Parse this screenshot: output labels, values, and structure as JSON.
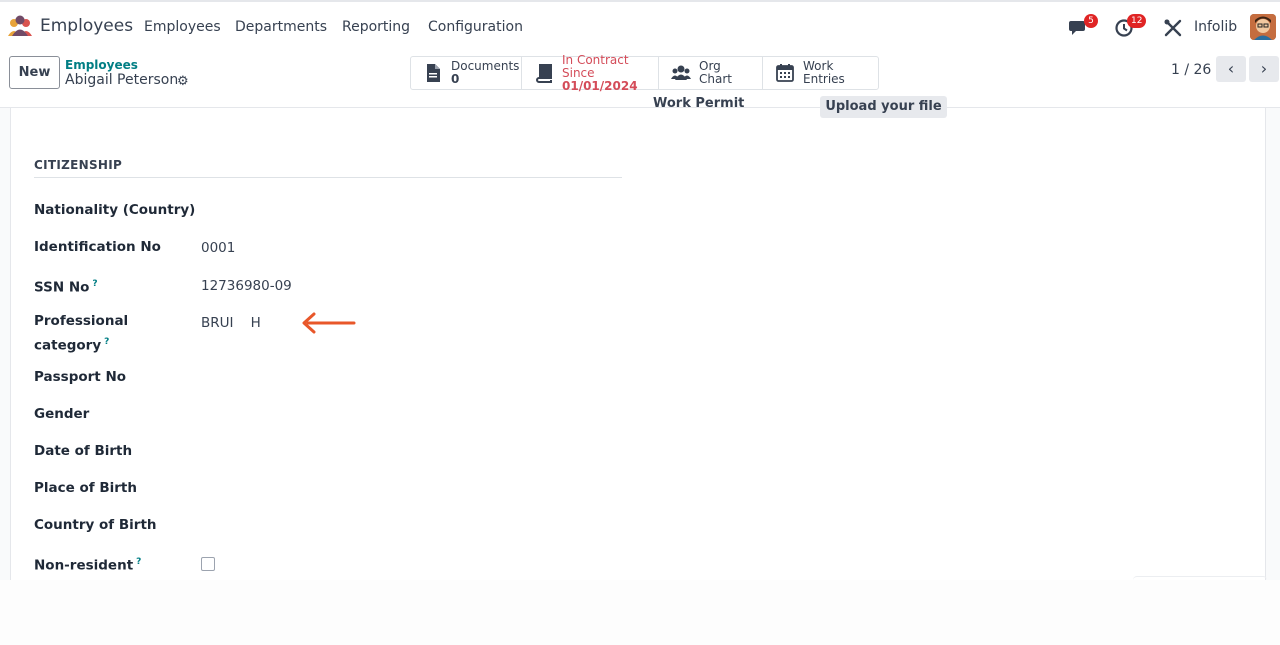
{
  "navbar": {
    "app_name": "Employees",
    "menu": [
      "Employees",
      "Departments",
      "Reporting",
      "Configuration"
    ],
    "messages_badge": "5",
    "activities_badge": "12",
    "company": "Infolib"
  },
  "control": {
    "new_label": "New",
    "breadcrumb": "Employees",
    "record_name": "Abigail Peterson",
    "smart_buttons": {
      "documents_label": "Documents",
      "documents_value": "0",
      "contract_label": "In Contract Since",
      "contract_value": "01/01/2024",
      "org_chart_label": "Org Chart",
      "work_entries_label": "Work Entries"
    },
    "pager": "1 / 26"
  },
  "form": {
    "work_permit_label": "Work Permit",
    "upload_label": "Upload your file",
    "citizenship": {
      "title": "CITIZENSHIP",
      "nationality_label": "Nationality (Country)",
      "identification_label": "Identification No",
      "identification_value": "0001",
      "ssn_label": "SSN No",
      "ssn_value": "12736980-09",
      "professional_label_1": "Professional",
      "professional_label_2": "category",
      "professional_value": "BRUI    H",
      "passport_label": "Passport No",
      "gender_label": "Gender",
      "dob_label": "Date of Birth",
      "pob_label": "Place of Birth",
      "cob_label": "Country of Birth",
      "non_resident_label": "Non-resident",
      "help_mark": "?"
    }
  },
  "colors": {
    "accent": "#017e84",
    "badge": "#e02424",
    "contract": "#d44c59",
    "arrow": "#e8572a",
    "app_icon": "#714b67"
  }
}
